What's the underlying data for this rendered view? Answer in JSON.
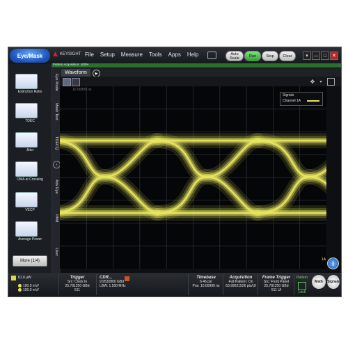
{
  "app": {
    "mode_button": "Eye/Mask",
    "brand": "KEYSIGHT",
    "menus": [
      "File",
      "Setup",
      "Measure",
      "Tools",
      "Apps",
      "Help"
    ],
    "auto_scale": "Auto Scale",
    "run": "Run",
    "stop": "Stop",
    "clear": "Clear",
    "pattern_label": "Pattern Acquisition: 100%",
    "window_buttons": {
      "menu": "▾",
      "min": "—",
      "max": "□",
      "close": "✕"
    }
  },
  "left_panel": {
    "measurements": [
      "Extinction Ratio",
      "TDEC",
      "Jitter",
      "OMA at Crossing",
      "VECP",
      "Average Power"
    ],
    "more": "More (1/4)"
  },
  "vertical_tabs": [
    "Eye Mode",
    "Mask Test",
    "TDECQ",
    "Adv Eye",
    "PAM",
    "User"
  ],
  "waveform": {
    "tab": "Waveform",
    "plot_info": "10.00999 ns",
    "legend_title": "Signals",
    "legend_channel": "Channel 1A",
    "marker": "1A",
    "colors": {
      "trace": "#e8e65e",
      "grid": "#2f3338"
    }
  },
  "bottom": {
    "channel": {
      "power": "61.0 µW",
      "scale1": "100.0 mV/",
      "scale2": "100.0 mV/"
    },
    "trigger": {
      "title": "Trigger",
      "line1": "Src: Clock In",
      "line2": "25.781250 GBd",
      "line3": "511"
    },
    "cdr": {
      "title": "CDR...",
      "line1": "9.9532800 GBd",
      "line2": "LBW: 1.500 MHz"
    },
    "timebase": {
      "title": "Timebase",
      "line1": "6.46 ps/",
      "line2": "Pos: 10.00999 ns"
    },
    "acquisition": {
      "title": "Acquisition",
      "line1": "Full Pattern: On",
      "line2": "63.99021526 pts/UI"
    },
    "frame_trigger": {
      "title": "Frame Trigger",
      "line1": "Src: Front Panel",
      "line2": "25.781250 GBd",
      "line3": "511 UI"
    },
    "pattern_lock": {
      "title": "Pattern",
      "state": "Lock"
    },
    "math": "Math",
    "signals": "Signals"
  }
}
